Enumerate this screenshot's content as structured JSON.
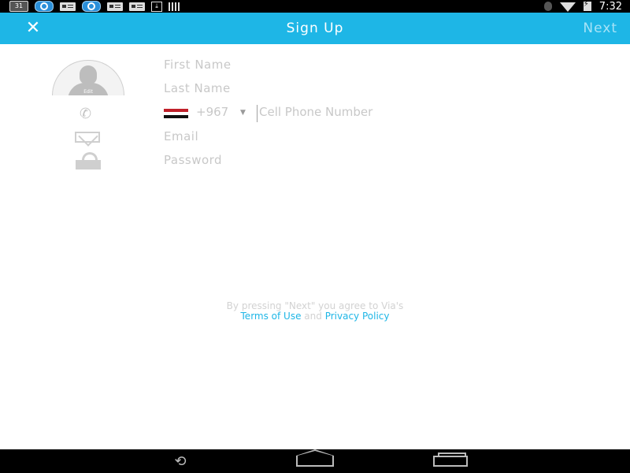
{
  "status_bar": {
    "calendar_day": "31",
    "time": "7:32",
    "left_icons": [
      "calendar-icon",
      "app-drop-icon",
      "card-icon",
      "app-drop-icon",
      "card-icon",
      "card-icon",
      "download-icon",
      "barcode-icon"
    ],
    "right_icons": [
      "bluetooth-icon",
      "wifi-icon",
      "battery-charging-icon"
    ]
  },
  "header": {
    "title": "Sign Up",
    "close_icon": "close-icon",
    "next_label": "Next",
    "color": "#1eb6e6"
  },
  "avatar": {
    "edit_label": "Edit"
  },
  "form": {
    "first_name_placeholder": "First Name",
    "last_name_placeholder": "Last Name",
    "country_code": "+967",
    "phone_placeholder": "Cell Phone Number",
    "email_placeholder": "Email",
    "password_placeholder": "Password"
  },
  "terms": {
    "line1": "By pressing \"Next\" you agree to Via's",
    "terms_link": "Terms of Use",
    "and_text": "and",
    "privacy_link": "Privacy Policy"
  },
  "nav": {
    "back_icon": "back-icon",
    "home_icon": "home-icon",
    "recent_icon": "recent-apps-icon"
  }
}
